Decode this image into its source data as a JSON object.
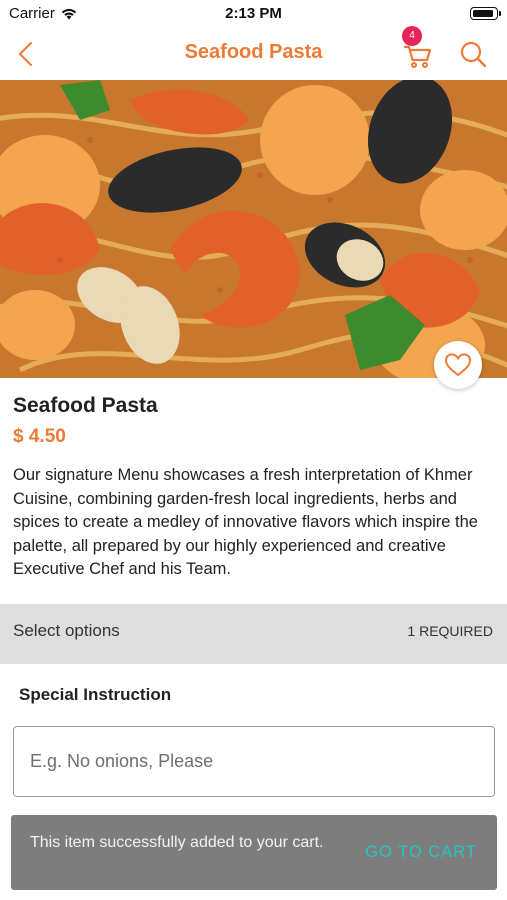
{
  "status_bar": {
    "carrier": "Carrier",
    "time": "2:13 PM"
  },
  "nav": {
    "title": "Seafood Pasta",
    "cart_badge": "4"
  },
  "product": {
    "name": "Seafood Pasta",
    "price": "$ 4.50",
    "description": "Our signature Menu showcases a fresh interpretation of Khmer Cuisine, combining garden-fresh local ingredients, herbs and spices to create a medley of innovative flavors which inspire the palette, all prepared by our highly experienced and creative Executive Chef and his Team."
  },
  "options": {
    "label": "Select options",
    "required": "1 REQUIRED"
  },
  "special_instruction": {
    "title": "Special Instruction",
    "placeholder": "E.g. No onions, Please"
  },
  "snackbar": {
    "message": "This item successfully added to your cart.",
    "action": "GO TO CART"
  },
  "colors": {
    "accent": "#ef7a35",
    "badge": "#e5245b",
    "snackbar_bg": "#7d7d7d",
    "snackbar_action": "#22c7c0",
    "options_bg": "#dedede"
  },
  "icons": [
    "wifi-icon",
    "battery-icon",
    "back-arrow-icon",
    "cart-icon",
    "search-icon",
    "heart-icon"
  ]
}
